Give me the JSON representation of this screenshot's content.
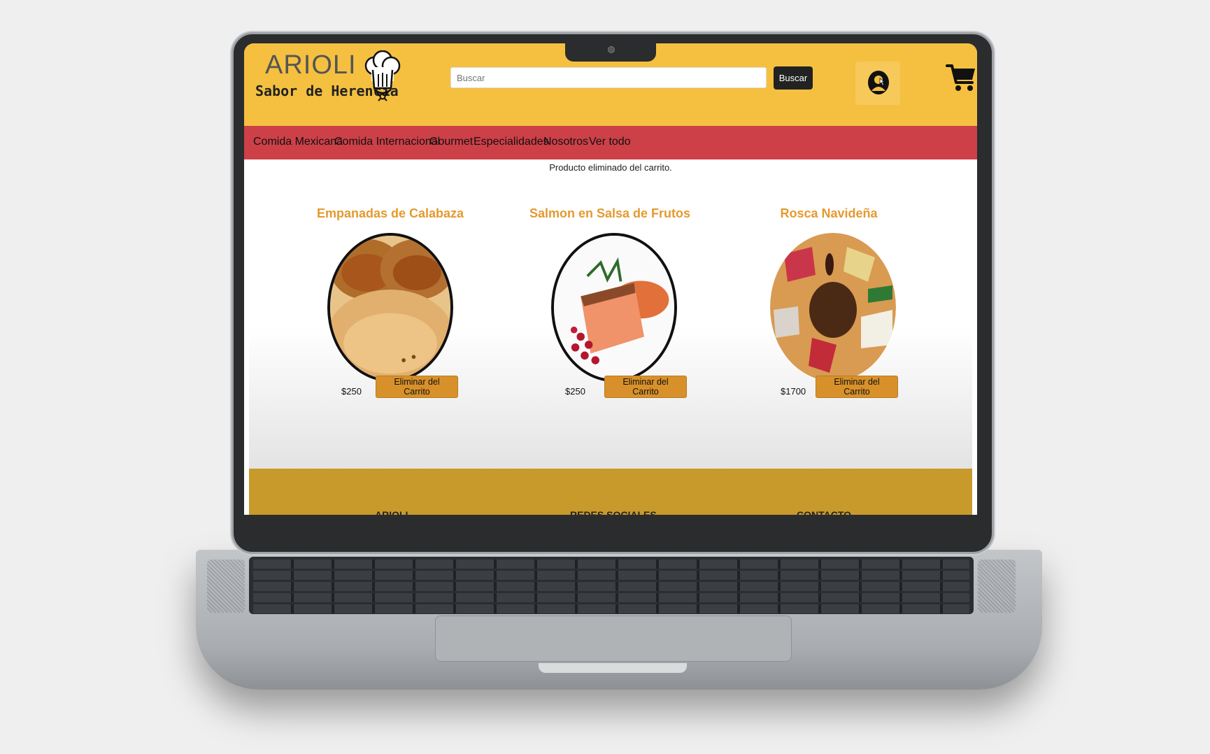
{
  "brand": {
    "name": "ARIOLI",
    "tagline": "Sabor de Herencia"
  },
  "search": {
    "placeholder": "Buscar",
    "button": "Buscar"
  },
  "nav": [
    {
      "label": "Comida Mexicana"
    },
    {
      "label": "Comida Internacional"
    },
    {
      "label": "Gourmet"
    },
    {
      "label": "Especialidades"
    },
    {
      "label": "Nosotros"
    },
    {
      "label": "Ver todo"
    }
  ],
  "message": "Producto eliminado del carrito.",
  "cart_items": [
    {
      "name": "Empanadas de Calabaza",
      "price": "$250",
      "button": "Eliminar del Carrito"
    },
    {
      "name": "Salmon en Salsa de Frutos",
      "price": "$250",
      "button": "Eliminar del Carrito"
    },
    {
      "name": "Rosca Navideña",
      "price": "$1700",
      "button": "Eliminar del Carrito"
    }
  ],
  "footer": {
    "col1": "ARIOLI",
    "col2": "REDES SOCIALES",
    "col3": "CONTACTO"
  },
  "icons": {
    "user": "user-avatar-icon",
    "cart": "shopping-cart-icon",
    "logo": "chef-hat-icon"
  },
  "colors": {
    "header": "#f5c040",
    "nav": "#cd4048",
    "accent": "#e49a2f",
    "button": "#d8912a",
    "footer": "#c89a2b"
  }
}
